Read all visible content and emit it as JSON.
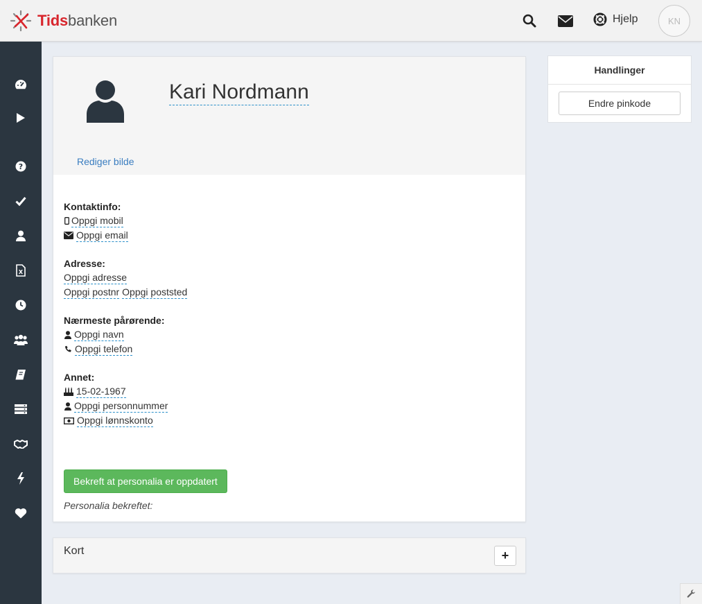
{
  "header": {
    "logo_tids": "Tids",
    "logo_banken": "banken",
    "help_label": "Hjelp",
    "avatar_initials": "KN",
    "icons": [
      "search-icon",
      "envelope-icon",
      "life-ring-icon"
    ]
  },
  "sidebar": {
    "items": [
      {
        "icon": "dashboard-icon"
      },
      {
        "icon": "play-icon"
      },
      {
        "icon": "question-icon"
      },
      {
        "icon": "check-icon"
      },
      {
        "icon": "user-icon"
      },
      {
        "icon": "excel-file-icon"
      },
      {
        "icon": "clock-icon"
      },
      {
        "icon": "users-icon"
      },
      {
        "icon": "book-icon"
      },
      {
        "icon": "server-icon"
      },
      {
        "icon": "handshake-icon"
      },
      {
        "icon": "bolt-icon"
      },
      {
        "icon": "heart-icon"
      }
    ]
  },
  "profile": {
    "name": "Kari Nordmann",
    "edit_photo": "Rediger bilde"
  },
  "contact": {
    "title": "Kontaktinfo:",
    "mobile": "Oppgi mobil",
    "email": "Oppgi email"
  },
  "address": {
    "title": "Adresse:",
    "street": "Oppgi adresse",
    "postnr": "Oppgi postnr",
    "poststed": "Oppgi poststed"
  },
  "relative": {
    "title": "Nærmeste pårørende:",
    "name": "Oppgi navn",
    "phone": "Oppgi telefon"
  },
  "other": {
    "title": "Annet:",
    "birthday": "15-02-1967",
    "personnummer": "Oppgi personnummer",
    "account": "Oppgi lønnskonto"
  },
  "confirm": {
    "button": "Bekreft at personalia er oppdatert",
    "status": "Personalia bekreftet:"
  },
  "card_panel": {
    "title": "Kort",
    "add_label": "+"
  },
  "actions": {
    "title": "Handlinger",
    "change_pin": "Endre pinkode"
  },
  "colors": {
    "sidebar": "#2b3640",
    "accent_link": "#3a7dc0",
    "success": "#5cb85c",
    "brand_red": "#d8262d"
  }
}
